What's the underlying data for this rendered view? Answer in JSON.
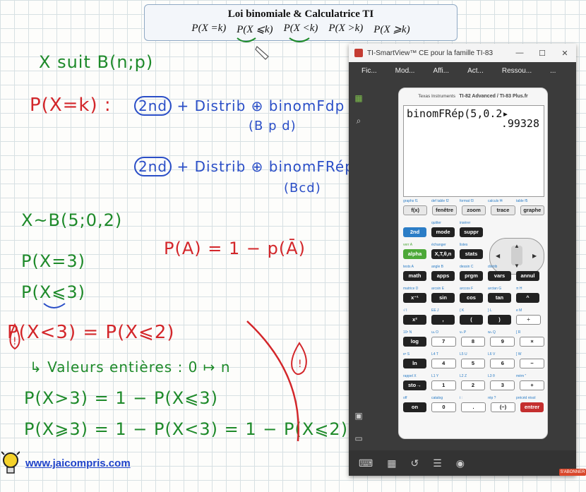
{
  "header": {
    "title": "Loi binomiale & Calculatrice TI",
    "formulas": [
      "P(X =k)",
      "P(X ⩽k)",
      "P(X <k)",
      "P(X >k)",
      "P(X ⩾k)"
    ]
  },
  "notes": {
    "line1": "X suit B(n;p)",
    "pxk": "P(X=k) :",
    "key2nd_a": "2nd",
    "seq_a": "+ Distrib ⊕ binomFdp",
    "args_a": "(B p d)",
    "key2nd_b": "2nd",
    "seq_b": "+ Distrib ⊕ binomFRép",
    "args_b": "(Bcd)",
    "xb": "X~B(5;0,2)",
    "pa": "P(A) = 1 − p(Ā)",
    "p3": "P(X=3)",
    "ple3": "P(X⩽3)",
    "plt3": "P(X<3) = P(X⩽2)",
    "valeurs": "↳ Valeurs entières : 0 ↦ n",
    "pgt3": "P(X>3) = 1 − P(X⩽3)",
    "pge3": "P(X⩾3) = 1 − P(X<3) = 1 − P(X⩽2)"
  },
  "footer": {
    "url": "www.jaicompris.com"
  },
  "emulator": {
    "window_title": "TI-SmartView™ CE pour la famille TI-83",
    "menus": [
      "Fic...",
      "Mod...",
      "Affi...",
      "Act...",
      "Ressou...",
      "..."
    ],
    "window_controls": [
      "—",
      "☐",
      "✕"
    ],
    "brand_left": "Texas Instruments",
    "brand_right": "TI-82 Advanced / TI-83 Plus.fr",
    "screen_line1": "binomFRép(5,0.2▸",
    "screen_line2": ".99328",
    "fkey_labels": [
      "graphs f1",
      "def table f2",
      "format f3",
      "calculs f4",
      "table f5"
    ],
    "fkeys": [
      "f(x)",
      "fenêtre",
      "zoom",
      "trace",
      "graphe"
    ],
    "row2_labels": [
      "",
      "quitter",
      "insérer"
    ],
    "row2": [
      "2nd",
      "mode",
      "suppr"
    ],
    "row3_labels": [
      "verr A",
      "échanger",
      "listes"
    ],
    "row3": [
      "alpha",
      "X,T,θ,n",
      "stats"
    ],
    "row4_labels": [
      "tests A",
      "angle B",
      "dessin C",
      "distrib"
    ],
    "row4": [
      "math",
      "apps",
      "prgm",
      "vars",
      "annul"
    ],
    "row5_labels": [
      "matrice D",
      "arcsin E",
      "arccos F",
      "arctan G",
      "π H"
    ],
    "row5": [
      "x⁻¹",
      "sin",
      "cos",
      "tan",
      "^"
    ],
    "row6_labels": [
      "√ I",
      "EE J",
      "{ K",
      "} L",
      "e M"
    ],
    "row6": [
      "x²",
      ",",
      "(",
      ")",
      "÷"
    ],
    "row7_labels": [
      "10ˣ N",
      "uₙ O",
      "vₙ P",
      "wₙ Q",
      "[ R"
    ],
    "row7": [
      "log",
      "7",
      "8",
      "9",
      "×"
    ],
    "row8_labels": [
      "eˣ S",
      "L4 T",
      "L5 U",
      "L6 V",
      "] W"
    ],
    "row8": [
      "ln",
      "4",
      "5",
      "6",
      "−"
    ],
    "row9_labels": [
      "rappel X",
      "L1 Y",
      "L2 Z",
      "L3 θ",
      "mém \""
    ],
    "row9": [
      "sto→",
      "1",
      "2",
      "3",
      "+"
    ],
    "row10_labels": [
      "off",
      "catalog",
      "i :",
      "rép ?",
      "précéd résol"
    ],
    "row10": [
      "on",
      "0",
      ".",
      "(−)",
      "entrer"
    ],
    "subscribe": "S'ABONNER"
  }
}
